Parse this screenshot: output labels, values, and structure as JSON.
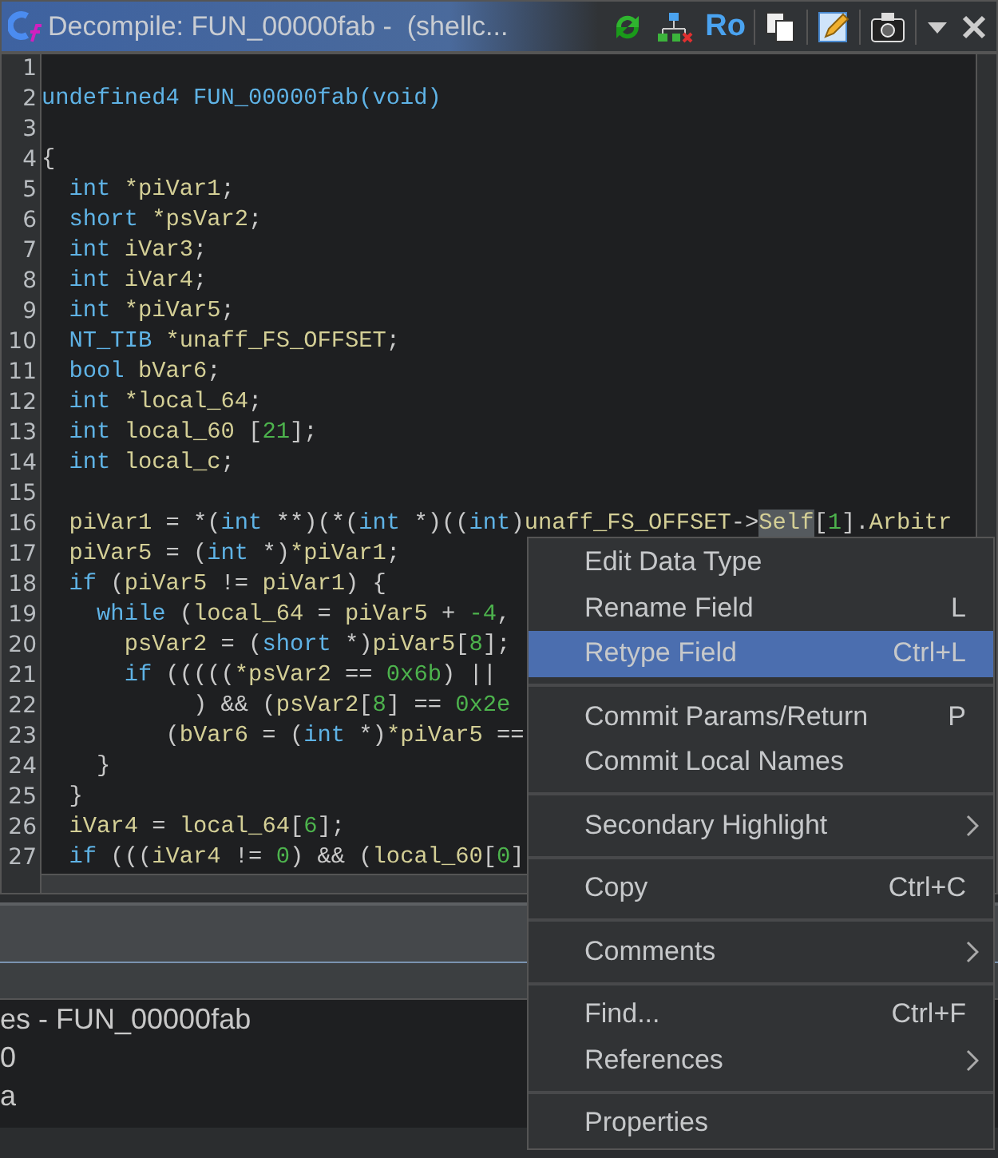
{
  "window": {
    "title": "Decompile: FUN_00000fab -  (shellc...",
    "toolbar_text": "Ro"
  },
  "code_lines": [
    {
      "number": "1"
    },
    {
      "number": "2",
      "tokens": [
        {
          "text": "undefined4 FUN_00000fab(void)",
          "kind": "type"
        }
      ]
    },
    {
      "number": "3"
    },
    {
      "number": "4",
      "tokens": [
        {
          "text": "{",
          "kind": "op"
        }
      ]
    },
    {
      "number": "5",
      "tokens": [
        {
          "text": "  int",
          "kind": "type"
        },
        {
          "text": " *piVar1",
          "kind": "id"
        },
        {
          "text": ";",
          "kind": "op"
        }
      ]
    },
    {
      "number": "6",
      "tokens": [
        {
          "text": "  short",
          "kind": "type"
        },
        {
          "text": " *psVar2",
          "kind": "id"
        },
        {
          "text": ";",
          "kind": "op"
        }
      ]
    },
    {
      "number": "7",
      "tokens": [
        {
          "text": "  int",
          "kind": "type"
        },
        {
          "text": " iVar3",
          "kind": "id"
        },
        {
          "text": ";",
          "kind": "op"
        }
      ]
    },
    {
      "number": "8",
      "tokens": [
        {
          "text": "  int",
          "kind": "type"
        },
        {
          "text": " iVar4",
          "kind": "id"
        },
        {
          "text": ";",
          "kind": "op"
        }
      ]
    },
    {
      "number": "9",
      "tokens": [
        {
          "text": "  int",
          "kind": "type"
        },
        {
          "text": " *piVar5",
          "kind": "id"
        },
        {
          "text": ";",
          "kind": "op"
        }
      ]
    },
    {
      "number": "10",
      "tokens": [
        {
          "text": "  NT_TIB",
          "kind": "type"
        },
        {
          "text": " *unaff_FS_OFFSET",
          "kind": "id"
        },
        {
          "text": ";",
          "kind": "op"
        }
      ]
    },
    {
      "number": "11",
      "tokens": [
        {
          "text": "  bool",
          "kind": "type"
        },
        {
          "text": " bVar6",
          "kind": "id"
        },
        {
          "text": ";",
          "kind": "op"
        }
      ]
    },
    {
      "number": "12",
      "tokens": [
        {
          "text": "  int",
          "kind": "type"
        },
        {
          "text": " *local_64",
          "kind": "id"
        },
        {
          "text": ";",
          "kind": "op"
        }
      ]
    },
    {
      "number": "13",
      "tokens": [
        {
          "text": "  int",
          "kind": "type"
        },
        {
          "text": " local_60 ",
          "kind": "id"
        },
        {
          "text": "[",
          "kind": "op"
        },
        {
          "text": "21",
          "kind": "num"
        },
        {
          "text": "];",
          "kind": "op"
        }
      ]
    },
    {
      "number": "14",
      "tokens": [
        {
          "text": "  int",
          "kind": "type"
        },
        {
          "text": " local_c",
          "kind": "id"
        },
        {
          "text": ";",
          "kind": "op"
        }
      ]
    },
    {
      "number": "15"
    },
    {
      "number": "16",
      "tokens": [
        {
          "text": "  piVar1",
          "kind": "id"
        },
        {
          "text": " = *(",
          "kind": "op"
        },
        {
          "text": "int",
          "kind": "type"
        },
        {
          "text": " **)(*(",
          "kind": "op"
        },
        {
          "text": "int",
          "kind": "type"
        },
        {
          "text": " *)((",
          "kind": "op"
        },
        {
          "text": "int",
          "kind": "type"
        },
        {
          "text": ")",
          "kind": "op"
        },
        {
          "text": "unaff_FS_OFFSET",
          "kind": "id"
        },
        {
          "text": "->",
          "kind": "op"
        },
        {
          "text": "Self",
          "kind": "hl"
        },
        {
          "text": "[",
          "kind": "op"
        },
        {
          "text": "1",
          "kind": "num"
        },
        {
          "text": "].",
          "kind": "op"
        },
        {
          "text": "Arbitr",
          "kind": "id"
        }
      ]
    },
    {
      "number": "17",
      "tokens": [
        {
          "text": "  piVar5",
          "kind": "id"
        },
        {
          "text": " = (",
          "kind": "op"
        },
        {
          "text": "int",
          "kind": "type"
        },
        {
          "text": " *)",
          "kind": "op"
        },
        {
          "text": "*piVar1",
          "kind": "id"
        },
        {
          "text": ";",
          "kind": "op"
        }
      ]
    },
    {
      "number": "18",
      "tokens": [
        {
          "text": "  if",
          "kind": "type"
        },
        {
          "text": " (",
          "kind": "op"
        },
        {
          "text": "piVar5",
          "kind": "id"
        },
        {
          "text": " != ",
          "kind": "op"
        },
        {
          "text": "piVar1",
          "kind": "id"
        },
        {
          "text": ") {",
          "kind": "op"
        }
      ]
    },
    {
      "number": "19",
      "tokens": [
        {
          "text": "    while",
          "kind": "type"
        },
        {
          "text": " (",
          "kind": "op"
        },
        {
          "text": "local_64",
          "kind": "id"
        },
        {
          "text": " = ",
          "kind": "op"
        },
        {
          "text": "piVar5",
          "kind": "id"
        },
        {
          "text": " + ",
          "kind": "op"
        },
        {
          "text": "-4",
          "kind": "num"
        },
        {
          "text": ",",
          "kind": "op"
        }
      ]
    },
    {
      "number": "20",
      "tokens": [
        {
          "text": "      psVar2",
          "kind": "id"
        },
        {
          "text": " = (",
          "kind": "op"
        },
        {
          "text": "short",
          "kind": "type"
        },
        {
          "text": " *)",
          "kind": "op"
        },
        {
          "text": "piVar5",
          "kind": "id"
        },
        {
          "text": "[",
          "kind": "op"
        },
        {
          "text": "8",
          "kind": "num"
        },
        {
          "text": "];",
          "kind": "op"
        }
      ]
    },
    {
      "number": "21",
      "tokens": [
        {
          "text": "      if",
          "kind": "type"
        },
        {
          "text": " (((((",
          "kind": "op"
        },
        {
          "text": "*psVar2",
          "kind": "id"
        },
        {
          "text": " == ",
          "kind": "op"
        },
        {
          "text": "0x6b",
          "kind": "num"
        },
        {
          "text": ") ||",
          "kind": "op"
        }
      ]
    },
    {
      "number": "22",
      "tokens": [
        {
          "text": "           ) && (",
          "kind": "op"
        },
        {
          "text": "psVar2",
          "kind": "id"
        },
        {
          "text": "[",
          "kind": "op"
        },
        {
          "text": "8",
          "kind": "num"
        },
        {
          "text": "] == ",
          "kind": "op"
        },
        {
          "text": "0x2e",
          "kind": "num"
        }
      ]
    },
    {
      "number": "23",
      "tokens": [
        {
          "text": "         (",
          "kind": "op"
        },
        {
          "text": "bVar6",
          "kind": "id"
        },
        {
          "text": " = (",
          "kind": "op"
        },
        {
          "text": "int",
          "kind": "type"
        },
        {
          "text": " *)",
          "kind": "op"
        },
        {
          "text": "*piVar5",
          "kind": "id"
        },
        {
          "text": " ==",
          "kind": "op"
        }
      ]
    },
    {
      "number": "24",
      "tokens": [
        {
          "text": "    }",
          "kind": "op"
        }
      ]
    },
    {
      "number": "25",
      "tokens": [
        {
          "text": "  }",
          "kind": "op"
        }
      ]
    },
    {
      "number": "26",
      "tokens": [
        {
          "text": "  iVar4",
          "kind": "id"
        },
        {
          "text": " = ",
          "kind": "op"
        },
        {
          "text": "local_64",
          "kind": "id"
        },
        {
          "text": "[",
          "kind": "op"
        },
        {
          "text": "6",
          "kind": "num"
        },
        {
          "text": "];",
          "kind": "op"
        }
      ]
    },
    {
      "number": "27",
      "tokens": [
        {
          "text": "  if",
          "kind": "type"
        },
        {
          "text": " (((",
          "kind": "op"
        },
        {
          "text": "iVar4",
          "kind": "id"
        },
        {
          "text": " != ",
          "kind": "op"
        },
        {
          "text": "0",
          "kind": "num"
        },
        {
          "text": ") && (",
          "kind": "op"
        },
        {
          "text": "local_60",
          "kind": "id"
        },
        {
          "text": "[",
          "kind": "op"
        },
        {
          "text": "0",
          "kind": "num"
        },
        {
          "text": "]",
          "kind": "op"
        }
      ]
    }
  ],
  "bottom_panel": {
    "rows": [
      "es - FUN_00000fab",
      "0",
      "a"
    ]
  },
  "context_menu": [
    [
      {
        "label": "Edit Data Type",
        "selected": false,
        "submenu": false
      },
      {
        "label": "Rename Field",
        "shortcut": "L",
        "selected": false,
        "submenu": false
      },
      {
        "label": "Retype Field",
        "shortcut": "Ctrl+L",
        "selected": true,
        "submenu": false
      }
    ],
    [
      {
        "label": "Commit Params/Return",
        "shortcut": "P",
        "selected": false,
        "submenu": false
      },
      {
        "label": "Commit Local Names",
        "selected": false,
        "submenu": false
      }
    ],
    [
      {
        "label": "Secondary Highlight",
        "selected": false,
        "submenu": true
      }
    ],
    [
      {
        "label": "Copy",
        "shortcut": "Ctrl+C",
        "selected": false,
        "submenu": false
      }
    ],
    [
      {
        "label": "Comments",
        "selected": false,
        "submenu": true
      }
    ],
    [
      {
        "label": "Find...",
        "shortcut": "Ctrl+F",
        "selected": false,
        "submenu": false
      },
      {
        "label": "References",
        "selected": false,
        "submenu": true
      }
    ],
    [
      {
        "label": "Properties",
        "selected": false,
        "submenu": false
      }
    ]
  ]
}
